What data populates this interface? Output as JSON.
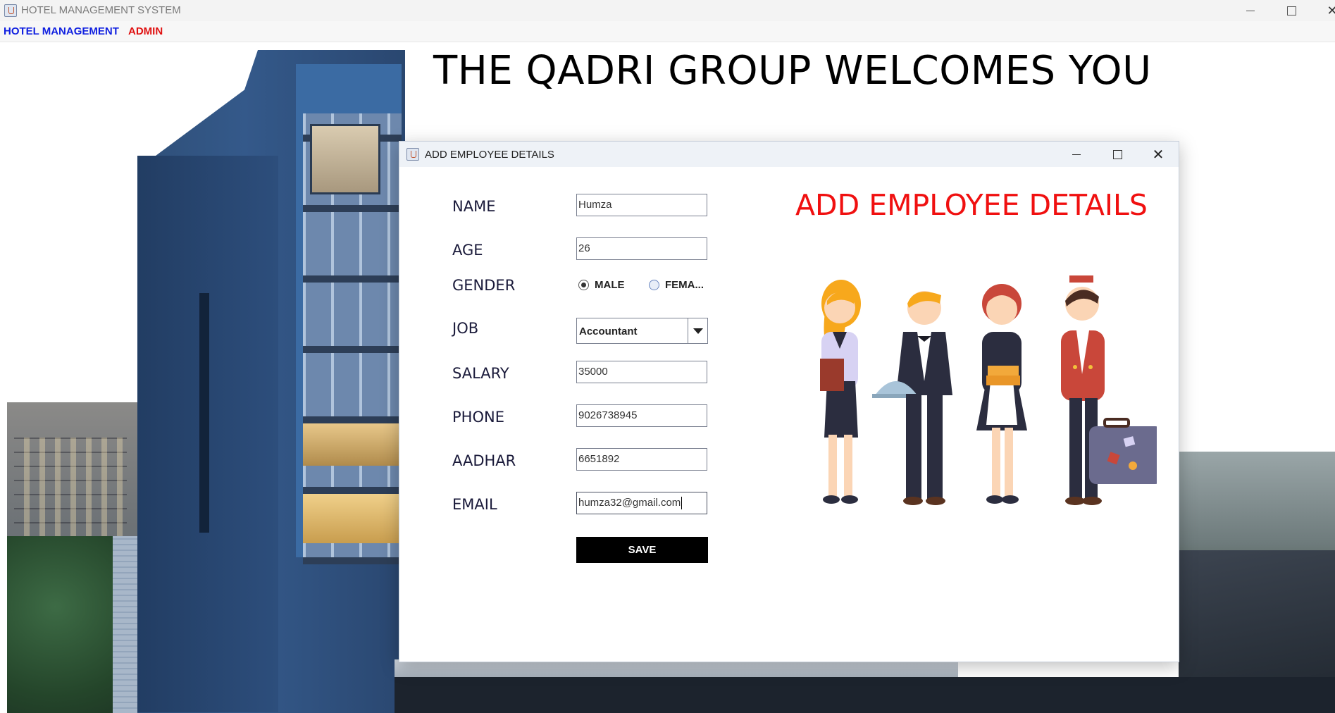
{
  "window": {
    "title": "HOTEL MANAGEMENT SYSTEM"
  },
  "menubar": {
    "items": [
      {
        "label": "HOTEL MANAGEMENT",
        "color": "#1020e0"
      },
      {
        "label": "ADMIN",
        "color": "#e01010"
      }
    ]
  },
  "background": {
    "welcome": "THE QADRI GROUP WELCOMES YOU"
  },
  "dialog": {
    "title": "ADD EMPLOYEE DETAILS",
    "heading": "ADD EMPLOYEE DETAILS",
    "heading_color": "#f01010",
    "labels": {
      "name": "NAME",
      "age": "AGE",
      "gender": "GENDER",
      "job": "JOB",
      "salary": "SALARY",
      "phone": "PHONE",
      "aadhar": "AADHAR",
      "email": "EMAIL"
    },
    "values": {
      "name": "Humza",
      "age": "26",
      "salary": "35000",
      "phone": "9026738945",
      "aadhar": "6651892",
      "email": "humza32@gmail.com"
    },
    "gender": {
      "male_label": "MALE",
      "female_label": "FEMA...",
      "selected": "MALE"
    },
    "job": {
      "selected": "Accountant"
    },
    "save_label": "SAVE"
  }
}
